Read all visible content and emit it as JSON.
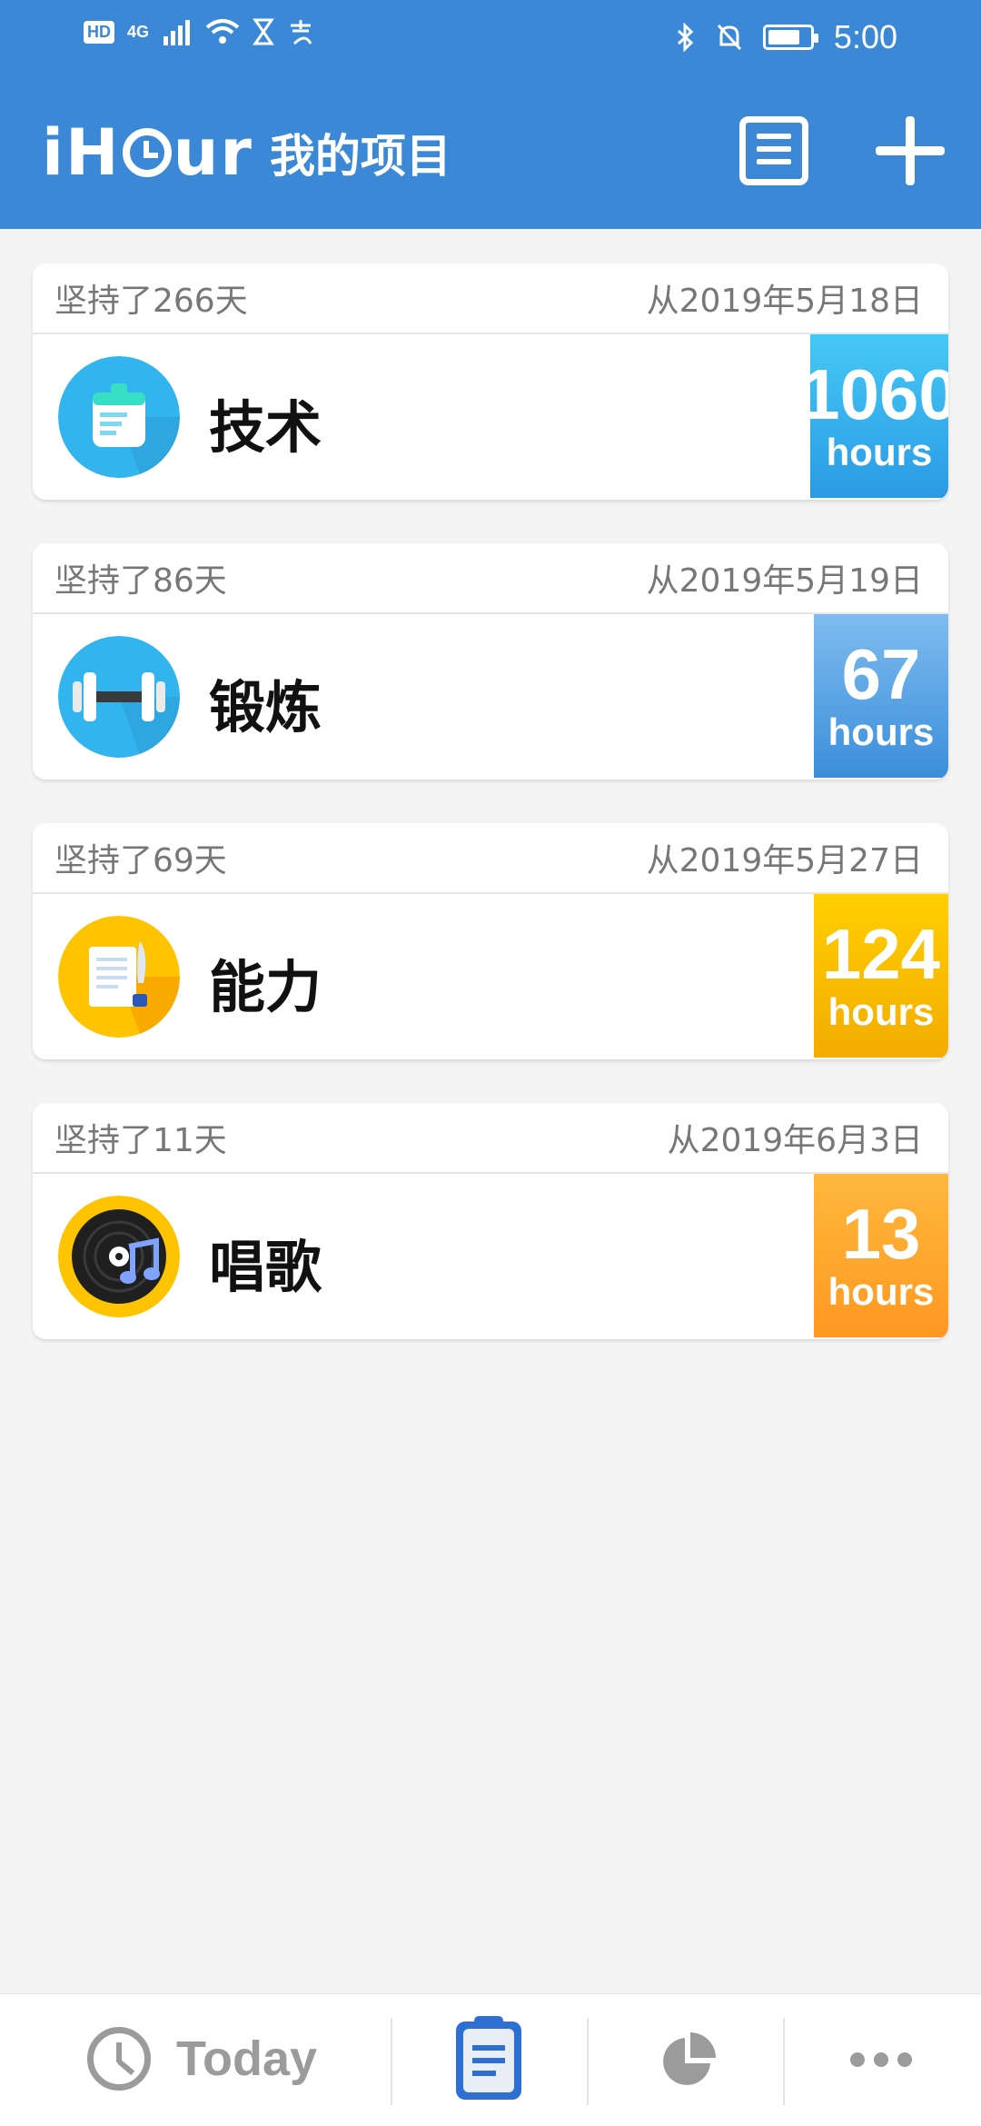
{
  "status_bar": {
    "time": "5:00",
    "network": "4G",
    "hd_label": "HD"
  },
  "header": {
    "logo_text_1": "iH",
    "logo_text_2": "ur",
    "title": "我的项目"
  },
  "projects": [
    {
      "persist_label": "坚持了266天",
      "since_label": "从2019年5月18日",
      "name": "技术",
      "hours": "1060",
      "hours_unit": "hours",
      "icon": "planner-icon",
      "colors": [
        "#3fc7f4",
        "#2a9ce6"
      ]
    },
    {
      "persist_label": "坚持了86天",
      "since_label": "从2019年5月19日",
      "name": "锻炼",
      "hours": "67",
      "hours_unit": "hours",
      "icon": "dumbbell-icon",
      "colors": [
        "#7bbcf0",
        "#3a8fdc"
      ]
    },
    {
      "persist_label": "坚持了69天",
      "since_label": "从2019年5月27日",
      "name": "能力",
      "hours": "124",
      "hours_unit": "hours",
      "icon": "document-quill-icon",
      "colors": [
        "#ffcf00",
        "#f5ae00"
      ]
    },
    {
      "persist_label": "坚持了11天",
      "since_label": "从2019年6月3日",
      "name": "唱歌",
      "hours": "13",
      "hours_unit": "hours",
      "icon": "music-record-icon",
      "colors": [
        "#ffb642",
        "#ff9a22"
      ]
    }
  ],
  "bottom_nav": {
    "today_label": "Today"
  }
}
